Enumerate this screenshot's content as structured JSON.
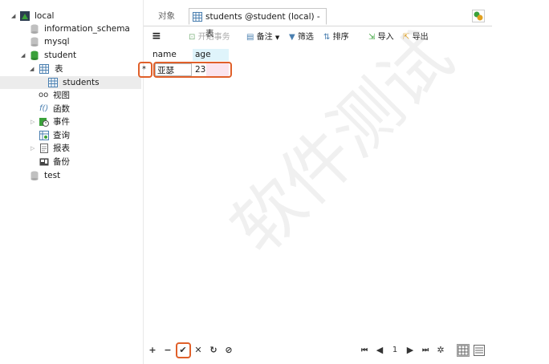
{
  "sidebar": {
    "connection": "local",
    "items": [
      {
        "label": "information_schema"
      },
      {
        "label": "mysql"
      },
      {
        "label": "student"
      },
      {
        "label": "表"
      },
      {
        "label": "students"
      },
      {
        "label": "视图"
      },
      {
        "label": "函数"
      },
      {
        "label": "事件"
      },
      {
        "label": "查询"
      },
      {
        "label": "报表"
      },
      {
        "label": "备份"
      },
      {
        "label": "test"
      }
    ]
  },
  "tabs": {
    "objects_label": "对象",
    "active_label": "students @student (local) - 表"
  },
  "toolbar": {
    "begin_transaction": "开始事务",
    "note": "备注",
    "filter": "筛选",
    "sort": "排序",
    "import": "导入",
    "export": "导出"
  },
  "grid": {
    "columns": [
      "name",
      "age"
    ],
    "rows": [
      {
        "marker": "*",
        "name": "亚瑟",
        "age": "23"
      }
    ]
  },
  "pager": {
    "page": "1"
  },
  "watermark": "软件测试",
  "colors": {
    "highlight": "#e0602a",
    "db_green": "#3aa13a",
    "header_bg": "#dff4fb"
  }
}
